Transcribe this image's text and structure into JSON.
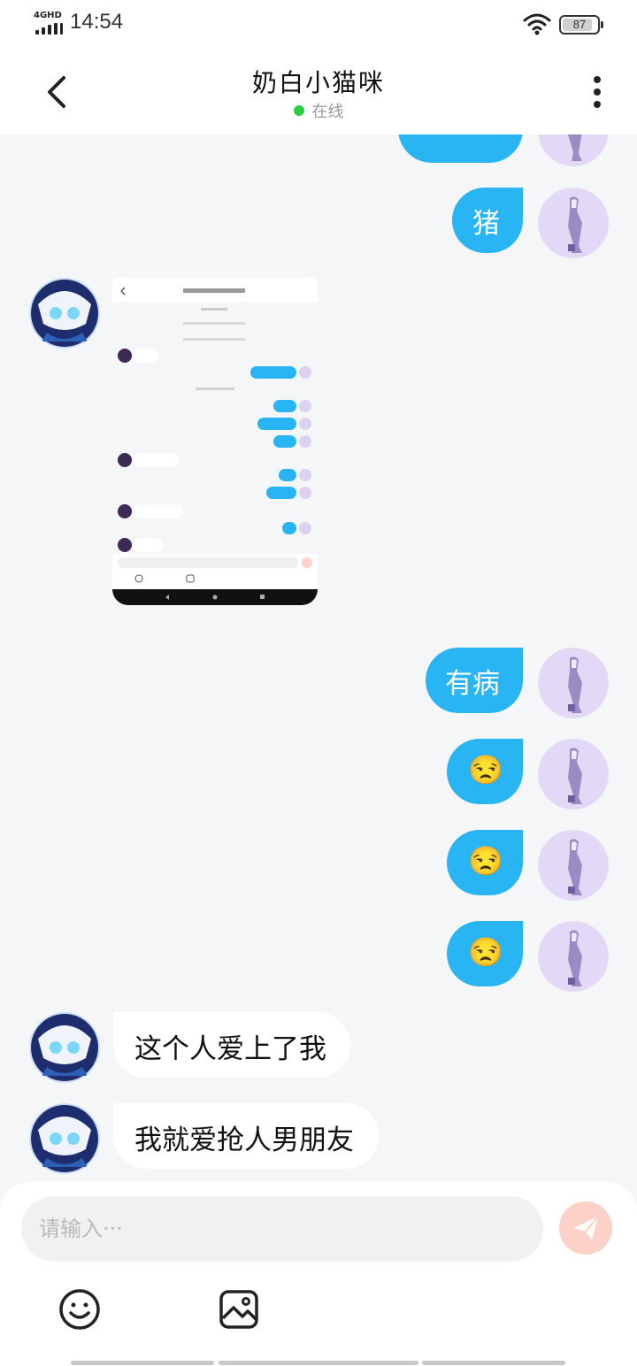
{
  "status_bar": {
    "network": "4GHD",
    "time": "14:54",
    "battery": "87",
    "battery_level": 0.87
  },
  "header": {
    "title": "奶白小猫咪",
    "status": "在线"
  },
  "messages": [
    {
      "side": "right",
      "type": "text",
      "text": "猪"
    },
    {
      "side": "left",
      "type": "image"
    },
    {
      "side": "right",
      "type": "text",
      "text": "有病"
    },
    {
      "side": "right",
      "type": "emoji",
      "text": "😒"
    },
    {
      "side": "right",
      "type": "emoji",
      "text": "😒"
    },
    {
      "side": "right",
      "type": "emoji",
      "text": "😒"
    },
    {
      "side": "left",
      "type": "text",
      "text": "这个人爱上了我"
    },
    {
      "side": "left",
      "type": "text",
      "text": "我就爱抢人男朋友"
    }
  ],
  "input": {
    "placeholder": "请输入···"
  },
  "colors": {
    "bubble_right": "#29b4f3",
    "bubble_left": "#ffffff",
    "background": "#f4f6f8",
    "online_dot": "#2ecc40",
    "send_button": "#fbd1c8"
  }
}
